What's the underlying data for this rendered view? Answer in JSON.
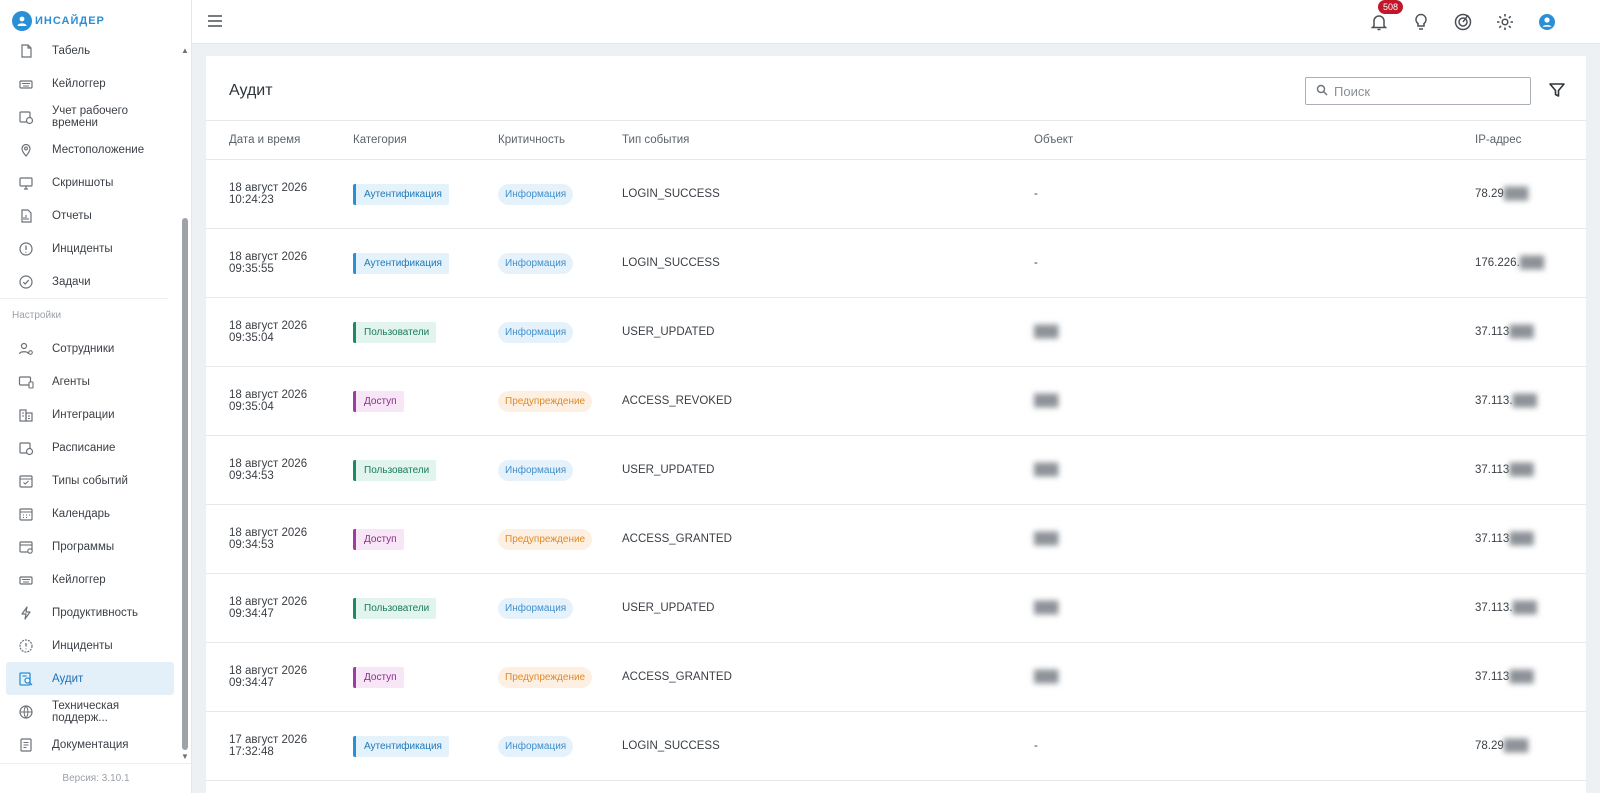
{
  "app": {
    "logo_text": "ИНСАЙДЕР"
  },
  "sidebar": {
    "items_top": [
      {
        "label": "Табель",
        "icon": "document-icon"
      },
      {
        "label": "Кейлоггер",
        "icon": "keyboard-icon"
      },
      {
        "label": "Учет рабочего времени",
        "icon": "calendar-clock-icon"
      },
      {
        "label": "Местоположение",
        "icon": "location-pin-icon"
      },
      {
        "label": "Скриншоты",
        "icon": "monitor-icon"
      },
      {
        "label": "Отчеты",
        "icon": "report-icon"
      },
      {
        "label": "Инциденты",
        "icon": "alert-circle-icon"
      },
      {
        "label": "Задачи",
        "icon": "check-circle-icon"
      }
    ],
    "section_label": "Настройки",
    "items_settings": [
      {
        "label": "Сотрудники",
        "icon": "user-settings-icon"
      },
      {
        "label": "Агенты",
        "icon": "monitor-agent-icon"
      },
      {
        "label": "Интеграции",
        "icon": "building-icon"
      },
      {
        "label": "Расписание",
        "icon": "calendar-clock-icon"
      },
      {
        "label": "Типы событий",
        "icon": "calendar-check-icon"
      },
      {
        "label": "Календарь",
        "icon": "calendar-icon"
      },
      {
        "label": "Программы",
        "icon": "window-icon"
      },
      {
        "label": "Кейлоггер",
        "icon": "keyboard-icon"
      },
      {
        "label": "Продуктивность",
        "icon": "lightning-icon"
      },
      {
        "label": "Инциденты",
        "icon": "alert-gear-icon"
      },
      {
        "label": "Аудит",
        "icon": "audit-search-icon",
        "active": true
      },
      {
        "label": "Техническая поддерж...",
        "icon": "support-globe-icon"
      },
      {
        "label": "Документация",
        "icon": "list-document-icon"
      }
    ],
    "version": "Версия: 3.10.1"
  },
  "topbar": {
    "notifications_count": "508"
  },
  "main": {
    "title": "Аудит",
    "search_placeholder": "Поиск",
    "columns": [
      "Дата и время",
      "Категория",
      "Критичность",
      "Тип события",
      "Объект",
      "IP-адрес"
    ],
    "rows": [
      {
        "datetime": "18 август 2026 10:24:23",
        "category": "Аутентификация",
        "category_type": "auth",
        "severity": "Информация",
        "severity_type": "info",
        "event": "LOGIN_SUCCESS",
        "object": "-",
        "object_blurred": false,
        "ip": "78.29",
        "ip_hidden": "███"
      },
      {
        "datetime": "18 август 2026 09:35:55",
        "category": "Аутентификация",
        "category_type": "auth",
        "severity": "Информация",
        "severity_type": "info",
        "event": "LOGIN_SUCCESS",
        "object": "-",
        "object_blurred": false,
        "ip": "176.226.",
        "ip_hidden": "███"
      },
      {
        "datetime": "18 август 2026 09:35:04",
        "category": "Пользователи",
        "category_type": "users",
        "severity": "Информация",
        "severity_type": "info",
        "event": "USER_UPDATED",
        "object": "███",
        "object_blurred": true,
        "ip": "37.113",
        "ip_hidden": "███"
      },
      {
        "datetime": "18 август 2026 09:35:04",
        "category": "Доступ",
        "category_type": "access",
        "severity": "Предупреждение",
        "severity_type": "warn",
        "event": "ACCESS_REVOKED",
        "object": "███",
        "object_blurred": true,
        "ip": "37.113.",
        "ip_hidden": "███"
      },
      {
        "datetime": "18 август 2026 09:34:53",
        "category": "Пользователи",
        "category_type": "users",
        "severity": "Информация",
        "severity_type": "info",
        "event": "USER_UPDATED",
        "object": "███",
        "object_blurred": true,
        "ip": "37.113",
        "ip_hidden": "███"
      },
      {
        "datetime": "18 август 2026 09:34:53",
        "category": "Доступ",
        "category_type": "access",
        "severity": "Предупреждение",
        "severity_type": "warn",
        "event": "ACCESS_GRANTED",
        "object": "███",
        "object_blurred": true,
        "ip": "37.113",
        "ip_hidden": "███"
      },
      {
        "datetime": "18 август 2026 09:34:47",
        "category": "Пользователи",
        "category_type": "users",
        "severity": "Информация",
        "severity_type": "info",
        "event": "USER_UPDATED",
        "object": "███",
        "object_blurred": true,
        "ip": "37.113.",
        "ip_hidden": "███"
      },
      {
        "datetime": "18 август 2026 09:34:47",
        "category": "Доступ",
        "category_type": "access",
        "severity": "Предупреждение",
        "severity_type": "warn",
        "event": "ACCESS_GRANTED",
        "object": "███",
        "object_blurred": true,
        "ip": "37.113",
        "ip_hidden": "███"
      },
      {
        "datetime": "17 август 2026 17:32:48",
        "category": "Аутентификация",
        "category_type": "auth",
        "severity": "Информация",
        "severity_type": "info",
        "event": "LOGIN_SUCCESS",
        "object": "-",
        "object_blurred": false,
        "ip": "78.29",
        "ip_hidden": "███"
      }
    ]
  },
  "colors": {
    "accent": "#2b8fd6",
    "badge": "#c0182a",
    "active_nav_bg": "#e3f0fa"
  }
}
